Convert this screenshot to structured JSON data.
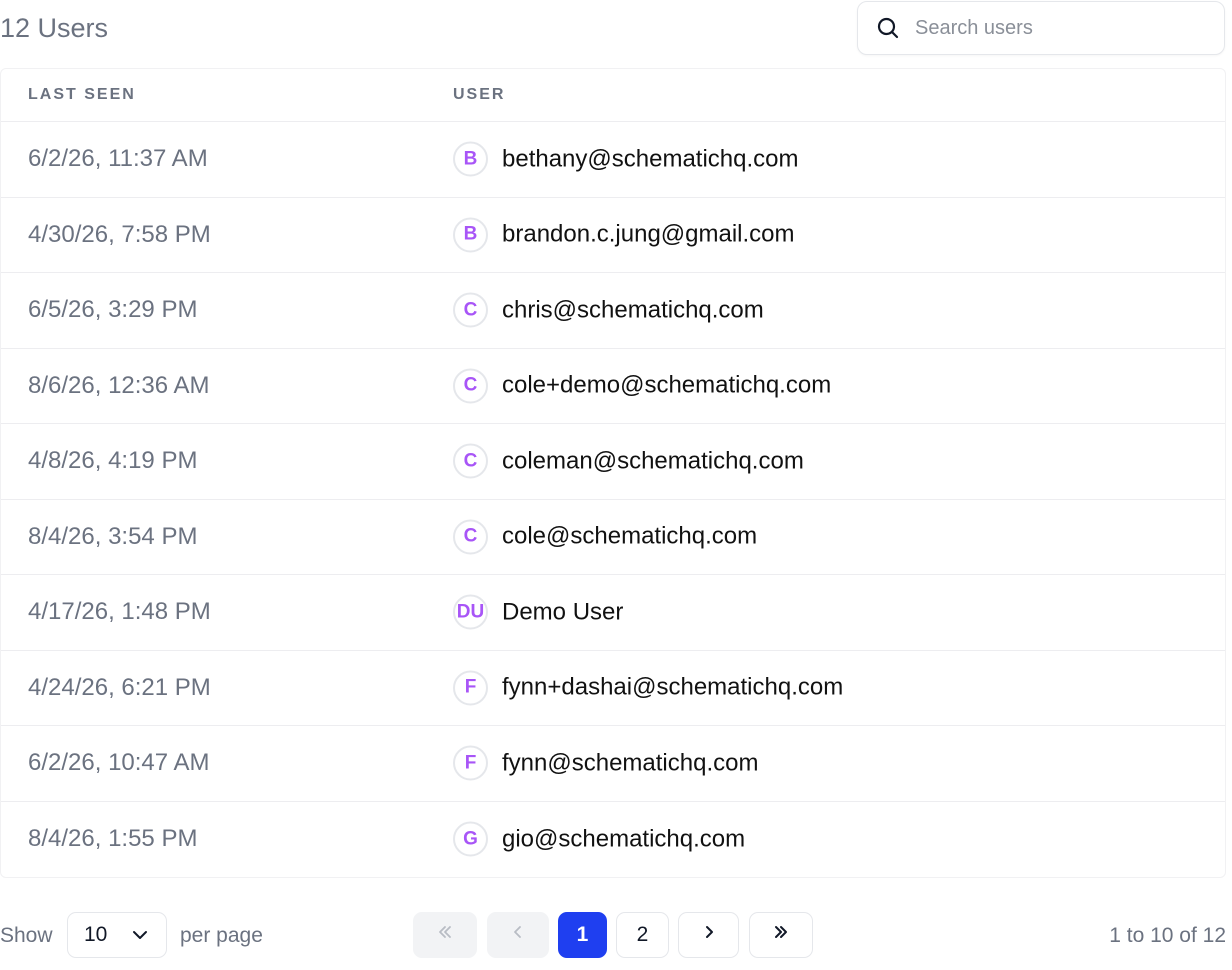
{
  "header": {
    "title": "12 Users",
    "search_placeholder": "Search users"
  },
  "table": {
    "columns": [
      "LAST SEEN",
      "USER"
    ],
    "rows": [
      {
        "last_seen": "6/2/26, 11:37 AM",
        "initials": "B",
        "user": "bethany@schematichq.com"
      },
      {
        "last_seen": "4/30/26, 7:58 PM",
        "initials": "B",
        "user": "brandon.c.jung@gmail.com"
      },
      {
        "last_seen": "6/5/26, 3:29 PM",
        "initials": "C",
        "user": "chris@schematichq.com"
      },
      {
        "last_seen": "8/6/26, 12:36 AM",
        "initials": "C",
        "user": "cole+demo@schematichq.com"
      },
      {
        "last_seen": "4/8/26, 4:19 PM",
        "initials": "C",
        "user": "coleman@schematichq.com"
      },
      {
        "last_seen": "8/4/26, 3:54 PM",
        "initials": "C",
        "user": "cole@schematichq.com"
      },
      {
        "last_seen": "4/17/26, 1:48 PM",
        "initials": "DU",
        "user": "Demo User"
      },
      {
        "last_seen": "4/24/26, 6:21 PM",
        "initials": "F",
        "user": "fynn+dashai@schematichq.com"
      },
      {
        "last_seen": "6/2/26, 10:47 AM",
        "initials": "F",
        "user": "fynn@schematichq.com"
      },
      {
        "last_seen": "8/4/26, 1:55 PM",
        "initials": "G",
        "user": "gio@schematichq.com"
      }
    ]
  },
  "pagination": {
    "show_label": "Show",
    "page_size": "10",
    "per_page_label": "per page",
    "pages": [
      "1",
      "2"
    ],
    "current_page": "1",
    "range_label": "1 to 10 of 12"
  },
  "colors": {
    "accent": "#1f3ff0",
    "avatar_text": "#a855f7",
    "muted_text": "#6b7280"
  },
  "icons": {
    "search": "search-icon",
    "select": "chevron-down-icon",
    "first": "double-chevron-left-icon",
    "prev": "chevron-left-icon",
    "next": "chevron-right-icon",
    "last": "double-chevron-right-icon"
  }
}
